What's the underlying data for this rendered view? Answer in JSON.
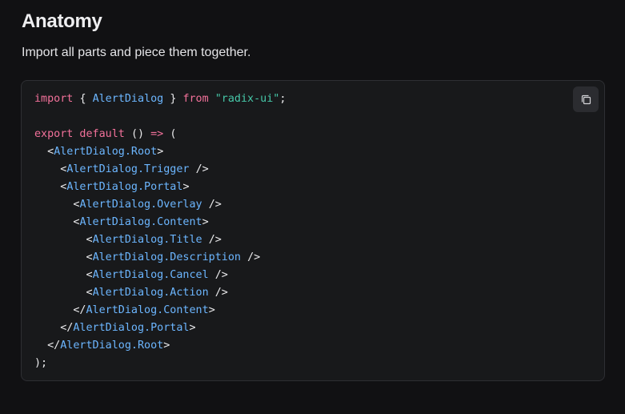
{
  "section": {
    "title": "Anatomy",
    "description": "Import all parts and piece them together."
  },
  "code_block": {
    "copy_icon": "copy-icon",
    "colors": {
      "keyword": "#f2719a",
      "identifier": "#6cb6ff",
      "string": "#46c7a8",
      "text": "#eaeaec",
      "background": "#18191b"
    },
    "tokens": {
      "import_kw": "import",
      "brace_open": "{",
      "alert_dialog": "AlertDialog",
      "brace_close": "}",
      "from_kw": "from",
      "module": "\"radix-ui\"",
      "semicolon": ";",
      "export_default": "export default",
      "parens": "()",
      "arrow": "=>",
      "paren_open": "(",
      "lt": "<",
      "lt_slash": "</",
      "gt": ">",
      "self_close": "/>",
      "close_stmt": ");",
      "root": "AlertDialog.Root",
      "trigger": "AlertDialog.Trigger",
      "portal": "AlertDialog.Portal",
      "overlay": "AlertDialog.Overlay",
      "content": "AlertDialog.Content",
      "title": "AlertDialog.Title",
      "description": "AlertDialog.Description",
      "cancel": "AlertDialog.Cancel",
      "action": "AlertDialog.Action"
    }
  }
}
